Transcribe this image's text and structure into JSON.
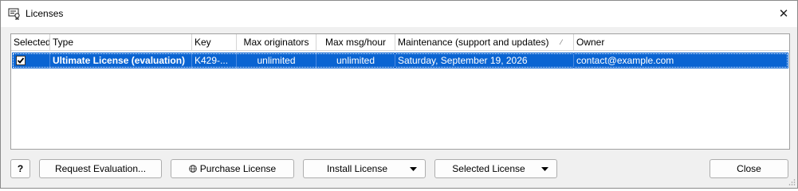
{
  "window": {
    "title": "Licenses",
    "close_glyph": "✕",
    "title_icon": "license-certificate-icon"
  },
  "grid": {
    "columns": [
      {
        "label": "Selected"
      },
      {
        "label": "Type"
      },
      {
        "label": "Key"
      },
      {
        "label": "Max originators"
      },
      {
        "label": "Max msg/hour"
      },
      {
        "label": "Maintenance (support and updates)",
        "sort_glyph": "⁄"
      },
      {
        "label": "Owner"
      }
    ],
    "rows": [
      {
        "selected": true,
        "type": "Ultimate License (evaluation)",
        "key": "K429-...",
        "max_originators": "unlimited",
        "max_msg_hour": "unlimited",
        "maintenance": "Saturday, September 19, 2026",
        "owner": "contact@example.com"
      }
    ],
    "selection_color": "#0a64d2"
  },
  "buttons": {
    "help": "?",
    "request_evaluation": "Request Evaluation...",
    "purchase_license": "Purchase License",
    "install_license": "Install License",
    "selected_license": "Selected License",
    "close": "Close"
  }
}
